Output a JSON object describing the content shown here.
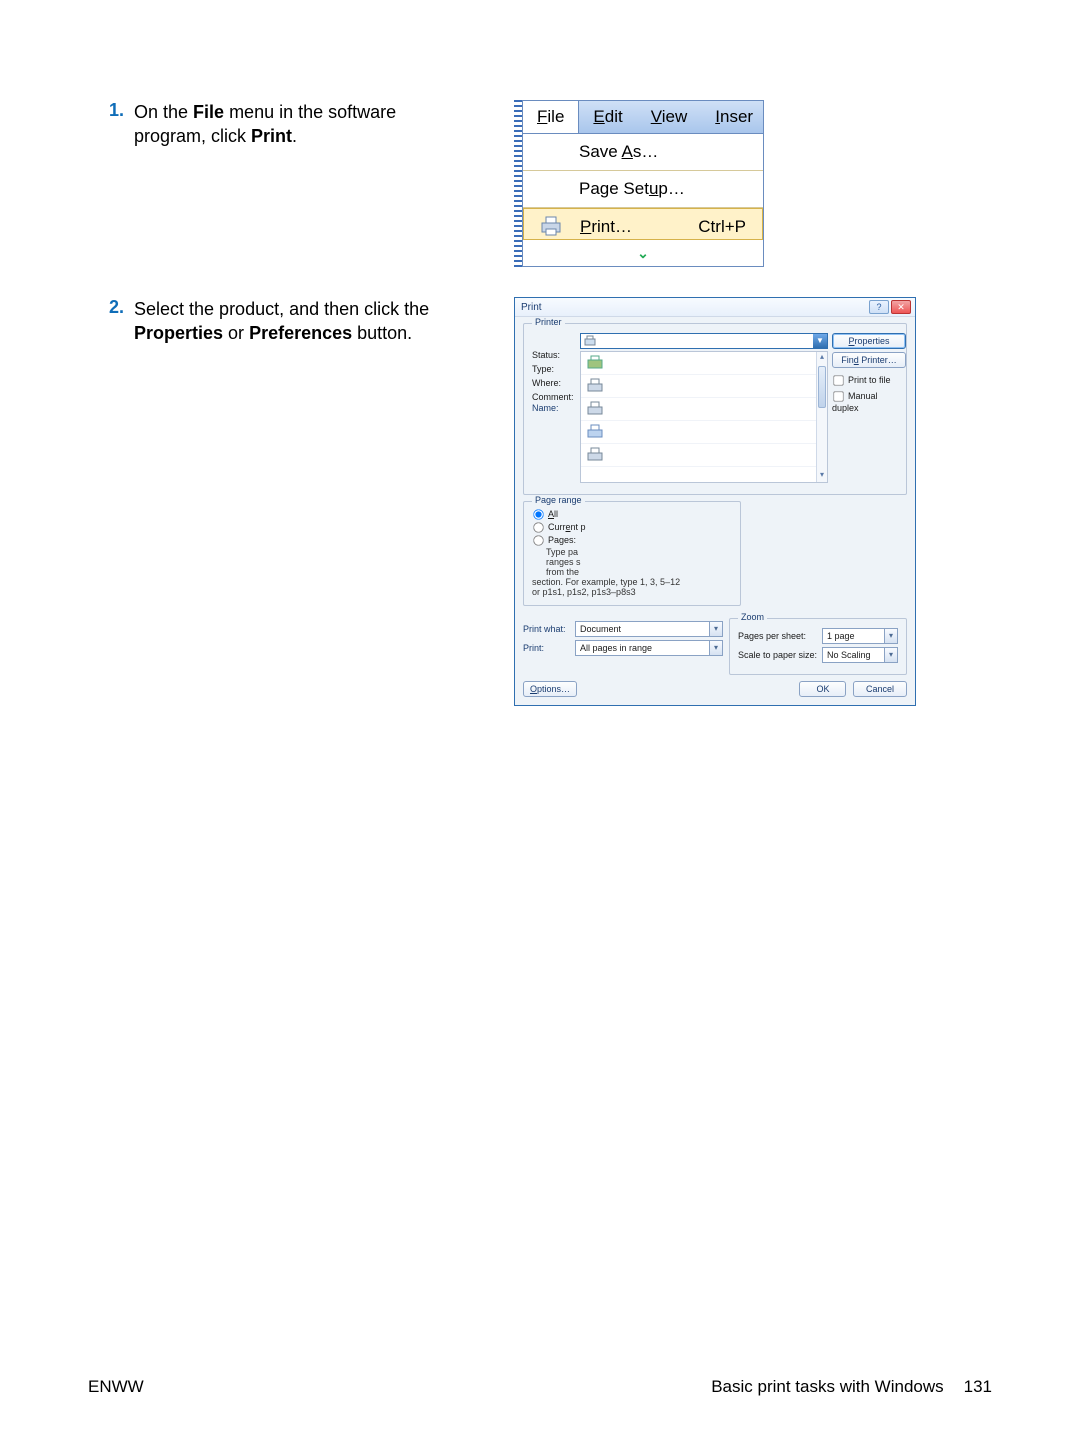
{
  "steps": {
    "s1": {
      "num": "1.",
      "text_pre": "On the ",
      "bold1": "File",
      "text_mid": " menu in the software program, click ",
      "bold2": "Print",
      "text_post": "."
    },
    "s2": {
      "num": "2.",
      "text_pre": "Select the product, and then click the ",
      "bold1": "Properties",
      "text_mid": " or ",
      "bold2": "Preferences",
      "text_post": " button."
    }
  },
  "menu": {
    "tabs": {
      "file": "File",
      "edit": "Edit",
      "view": "View",
      "insert": "Inser"
    },
    "items": {
      "save_as": "Save As…",
      "page_setup": "Page Setup…",
      "print": "Print…",
      "print_shortcut": "Ctrl+P"
    }
  },
  "dlg": {
    "title": "Print",
    "printer": {
      "legend": "Printer",
      "name": "Name:",
      "status": "Status:",
      "type": "Type:",
      "where": "Where:",
      "comment": "Comment:",
      "properties": "Properties",
      "find": "Find Printer…",
      "to_file": "Print to file",
      "manual": "Manual duplex"
    },
    "range": {
      "legend": "Page range",
      "all": "All",
      "current": "Current p",
      "pages": "Pages:",
      "hint1": "Type pa",
      "hint2": "ranges s",
      "hint3": "from the",
      "hint4": "section. For example, type 1, 3, 5–12",
      "hint5": "or p1s1, p1s2, p1s3–p8s3"
    },
    "what": {
      "label": "Print what:",
      "val": "Document",
      "print_label": "Print:",
      "print_val": "All pages in range"
    },
    "zoom": {
      "legend": "Zoom",
      "pps": "Pages per sheet:",
      "pps_val": "1 page",
      "scale": "Scale to paper size:",
      "scale_val": "No Scaling"
    },
    "buttons": {
      "options": "Options…",
      "ok": "OK",
      "cancel": "Cancel"
    }
  },
  "footer": {
    "left": "ENWW",
    "right": "Basic print tasks with Windows",
    "page": "131"
  }
}
